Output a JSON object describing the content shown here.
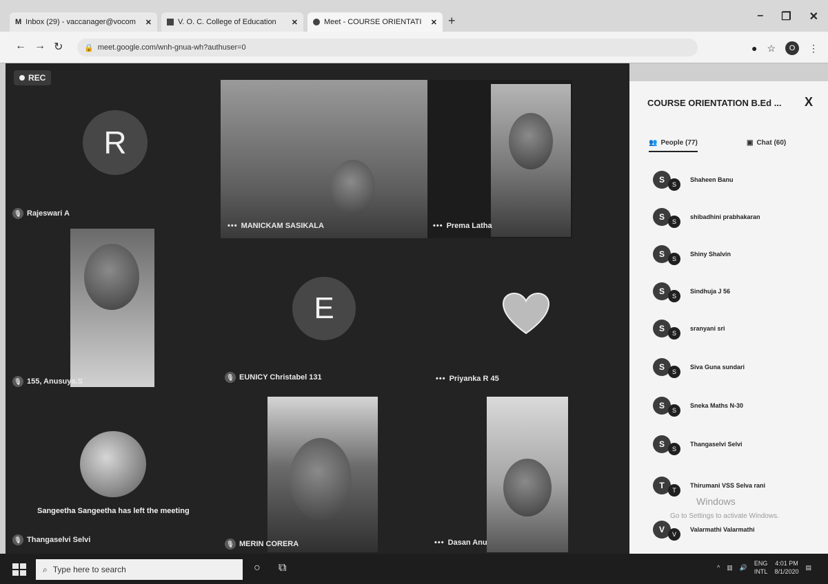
{
  "browser": {
    "tabs": [
      {
        "label": "Inbox (29) - vaccanager@vocom",
        "icon": "gmail-icon"
      },
      {
        "label": "V. O. C. College of Education",
        "icon": "site-icon"
      },
      {
        "label": "Meet - COURSE ORIENTATI",
        "icon": "meet-icon"
      }
    ],
    "new_tab_label": "+",
    "url": "meet.google.com/wnh-gnua-wh?authuser=0",
    "profile_initial": "O"
  },
  "meet": {
    "rec_label": "REC",
    "tiles": [
      {
        "name": "Rajeswari A",
        "avatar": "R"
      },
      {
        "name": "MANICKAM SASIKALA"
      },
      {
        "name": "Prema Latha"
      },
      {
        "name": "155, Anusuya.S"
      },
      {
        "name": "EUNICY Christabel 131",
        "avatar": "E"
      },
      {
        "name": "Priyanka R 45"
      },
      {
        "name": "Thangaselvi Selvi"
      },
      {
        "name": "MERIN CORERA"
      },
      {
        "name": "Dasan Anu"
      }
    ],
    "toast": "Sangeetha Sangeetha has left the meeting"
  },
  "panel": {
    "title": "COURSE ORIENTATION B.Ed ...",
    "close": "X",
    "people_tab": "People (77)",
    "chat_tab": "Chat (60)",
    "people": [
      {
        "initial": "S",
        "name": "Shaheen Banu"
      },
      {
        "initial": "S",
        "name": "shibadhini prabhakaran"
      },
      {
        "initial": "S",
        "name": "Shiny Shalvin"
      },
      {
        "initial": "S",
        "name": "Sindhuja J 56"
      },
      {
        "initial": "S",
        "name": "sranyani sri"
      },
      {
        "initial": "S",
        "name": "Siva Guna sundari"
      },
      {
        "initial": "S",
        "name": "Sneka Maths N-30"
      },
      {
        "initial": "S",
        "name": "Thangaselvi Selvi"
      },
      {
        "initial": "T",
        "name": "Thirumani VSS Selva rani"
      },
      {
        "initial": "V",
        "name": "Valarmathi Valarmathi"
      }
    ],
    "watermark_title": "Windows",
    "watermark_sub": "Go to Settings to activate Windows."
  },
  "taskbar": {
    "search_placeholder": "Type here to search",
    "lang": "ENG",
    "region": "INTL",
    "time": "4:01 PM",
    "date": "8/1/2020"
  }
}
